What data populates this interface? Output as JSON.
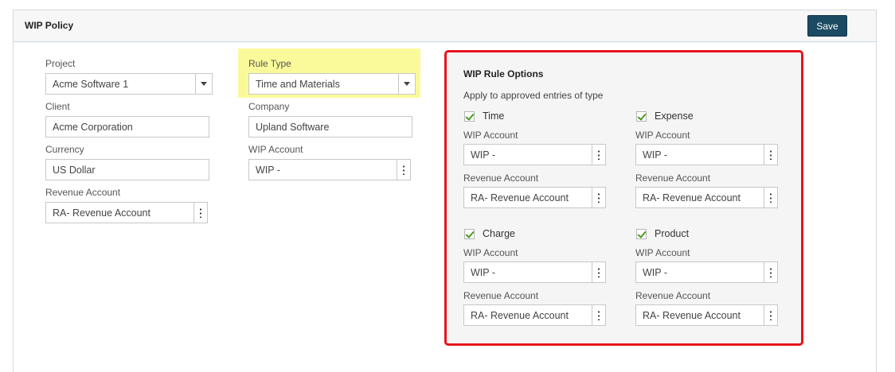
{
  "header": {
    "title": "WIP Policy",
    "save_label": "Save"
  },
  "left": {
    "project": {
      "label": "Project",
      "value": "Acme Software 1"
    },
    "client": {
      "label": "Client",
      "value": "Acme Corporation"
    },
    "currency": {
      "label": "Currency",
      "value": "US Dollar"
    },
    "revenue_account": {
      "label": "Revenue Account",
      "value": "RA- Revenue Account"
    }
  },
  "middle": {
    "rule_type": {
      "label": "Rule Type",
      "value": "Time and Materials"
    },
    "company": {
      "label": "Company",
      "value": "Upland Software"
    },
    "wip_account": {
      "label": "WIP Account",
      "value": "WIP -"
    }
  },
  "options": {
    "title": "WIP Rule Options",
    "subtitle": "Apply to approved entries of type",
    "groups": [
      {
        "name": "Time",
        "checked": true,
        "wip_label": "WIP Account",
        "wip_value": "WIP -",
        "rev_label": "Revenue Account",
        "rev_value": "RA- Revenue Account"
      },
      {
        "name": "Expense",
        "checked": true,
        "wip_label": "WIP Account",
        "wip_value": "WIP -",
        "rev_label": "Revenue Account",
        "rev_value": "RA- Revenue Account"
      },
      {
        "name": "Charge",
        "checked": true,
        "wip_label": "WIP Account",
        "wip_value": "WIP -",
        "rev_label": "Revenue Account",
        "rev_value": "RA- Revenue Account"
      },
      {
        "name": "Product",
        "checked": true,
        "wip_label": "WIP Account",
        "wip_value": "WIP -",
        "rev_label": "Revenue Account",
        "rev_value": "RA- Revenue Account"
      }
    ]
  },
  "colors": {
    "save_button": "#1c4a62",
    "highlight": "#fbfa9b",
    "options_border": "#e8141c",
    "check": "#4a9a1e"
  }
}
